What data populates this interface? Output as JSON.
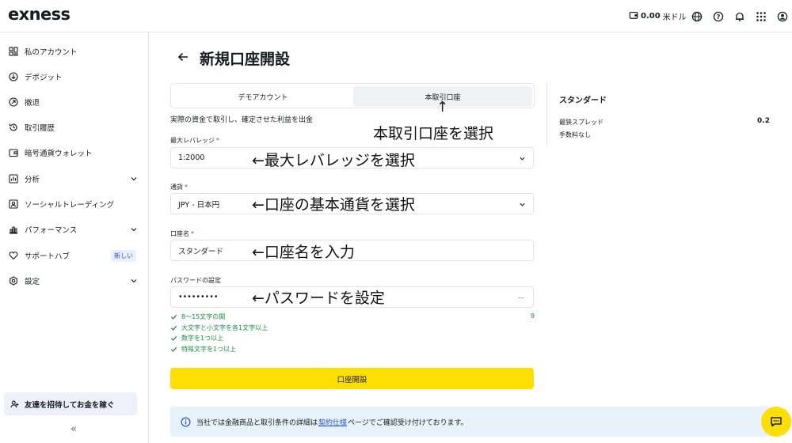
{
  "header": {
    "logo": "exness",
    "balance_amount": "0.00",
    "balance_currency": "米ドル",
    "icons": [
      "wallet-icon",
      "globe-icon",
      "help-icon",
      "bell-icon",
      "apps-grid-icon",
      "account-icon"
    ]
  },
  "sidebar": {
    "items": [
      {
        "label": "私のアカウント",
        "icon": "dashboard-icon"
      },
      {
        "label": "デポジット",
        "icon": "deposit-icon"
      },
      {
        "label": "撤退",
        "icon": "withdraw-icon"
      },
      {
        "label": "取引履歴",
        "icon": "history-icon"
      },
      {
        "label": "暗号通貨ウォレット",
        "icon": "wallet-icon"
      },
      {
        "label": "分析",
        "icon": "analytics-icon"
      },
      {
        "label": "ソーシャルトレーディング",
        "icon": "social-trading-icon"
      },
      {
        "label": "パフォーマンス",
        "icon": "performance-icon"
      },
      {
        "label": "サポートハブ",
        "icon": "heart-icon",
        "badge": "新しい"
      },
      {
        "label": "設定",
        "icon": "settings-icon"
      }
    ],
    "invite_label": "友達を招待してお金を稼ぐ",
    "collapse_label": "«"
  },
  "main": {
    "title": "新規口座開設",
    "tabs": {
      "demo": "デモアカウント",
      "real": "本取引口座"
    },
    "description": "実際の資金で取引し、確定させた利益を出金",
    "leverage": {
      "label": "最大レバレッジ",
      "required": "*",
      "value": "1:2000"
    },
    "currency": {
      "label": "通貨",
      "required": "*",
      "value": "JPY - 日本円"
    },
    "account_name": {
      "label": "口座名",
      "required": "*",
      "value": "スタンダード"
    },
    "password": {
      "label": "パスワードの設定",
      "value": "•••••••••",
      "toggle_hint": "ｰｰ",
      "count": "9"
    },
    "password_rules": [
      "8～15文字の間",
      "大文字と小文字を各1文字以上",
      "数字を1つ以上",
      "特殊文字を1つ以上"
    ],
    "submit_label": "口座開設",
    "info": {
      "text_before": "当社では金融商品と取引条件の詳細は",
      "link": "契約仕様",
      "text_after": "ページでご確認受け付けております。"
    }
  },
  "annotations": {
    "arrow_up": "↑",
    "tab": "本取引口座を選択",
    "leverage": "←最大レバレッジを選択",
    "currency": "←口座の基本通貨を選択",
    "account_name": "←口座名を入力",
    "password": "←パスワードを設定"
  },
  "summary": {
    "title": "スタンダード",
    "rows": [
      {
        "label": "最狭スプレッド",
        "value": "0.2"
      },
      {
        "label": "手数料なし",
        "value": ""
      }
    ]
  },
  "colors": {
    "accent": "#ffde02",
    "success": "#1e8a44",
    "link": "#2a55d6",
    "info_bg": "#e7f2fb"
  }
}
